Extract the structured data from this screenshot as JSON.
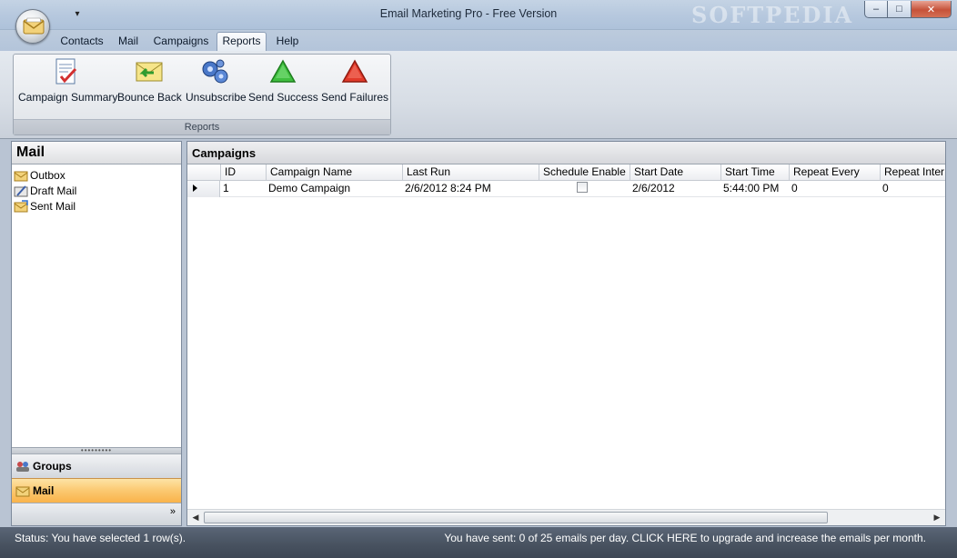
{
  "window": {
    "title": "Email Marketing Pro - Free Version",
    "watermark": "SOFTPEDIA",
    "qat_glyph": "▾",
    "min_glyph": "‒",
    "max_glyph": "□",
    "close_glyph": "✕"
  },
  "menu": {
    "tabs": [
      {
        "label": "Contacts"
      },
      {
        "label": "Mail"
      },
      {
        "label": "Campaigns"
      },
      {
        "label": "Reports",
        "active": true
      },
      {
        "label": "Help"
      }
    ]
  },
  "ribbon": {
    "group_label": "Reports",
    "buttons": [
      {
        "label": "Campaign Summary",
        "icon": "campaign-summary-icon"
      },
      {
        "label": "Bounce Back",
        "icon": "bounce-back-icon"
      },
      {
        "label": "Unsubscribe",
        "icon": "unsubscribe-icon"
      },
      {
        "label": "Send Success",
        "icon": "send-success-icon"
      },
      {
        "label": "Send Failures",
        "icon": "send-failures-icon"
      }
    ]
  },
  "nav": {
    "header": "Mail",
    "tree": [
      {
        "label": "Outbox",
        "icon": "outbox-icon"
      },
      {
        "label": "Draft Mail",
        "icon": "draft-mail-icon"
      },
      {
        "label": "Sent Mail",
        "icon": "sent-mail-icon"
      }
    ],
    "splitter_glyph": "•••••••••",
    "groups_label": "Groups",
    "mail_label": "Mail",
    "expand_glyph": "»"
  },
  "grid": {
    "title": "Campaigns",
    "columns": [
      "ID",
      "Campaign Name",
      "Last Run",
      "Schedule Enable",
      "Start Date",
      "Start Time",
      "Repeat Every",
      "Repeat Inter"
    ],
    "rows": [
      {
        "id": "1",
        "campaign_name": "Demo Campaign",
        "last_run": "2/6/2012 8:24 PM",
        "schedule_enabled": false,
        "start_date": "2/6/2012",
        "start_time": "5:44:00 PM",
        "repeat_every": "0",
        "repeat_interval": "0"
      }
    ],
    "scroll_left_glyph": "◀",
    "scroll_right_glyph": "▶"
  },
  "status": {
    "left": "Status: You have selected 1 row(s).",
    "right": "You have sent: 0 of 25 emails per day. CLICK HERE to upgrade and increase the emails per month."
  },
  "colors": {
    "accent_mail": "#fbc870",
    "statusbar": "#47515f",
    "titlebar": "#b6c8de"
  }
}
